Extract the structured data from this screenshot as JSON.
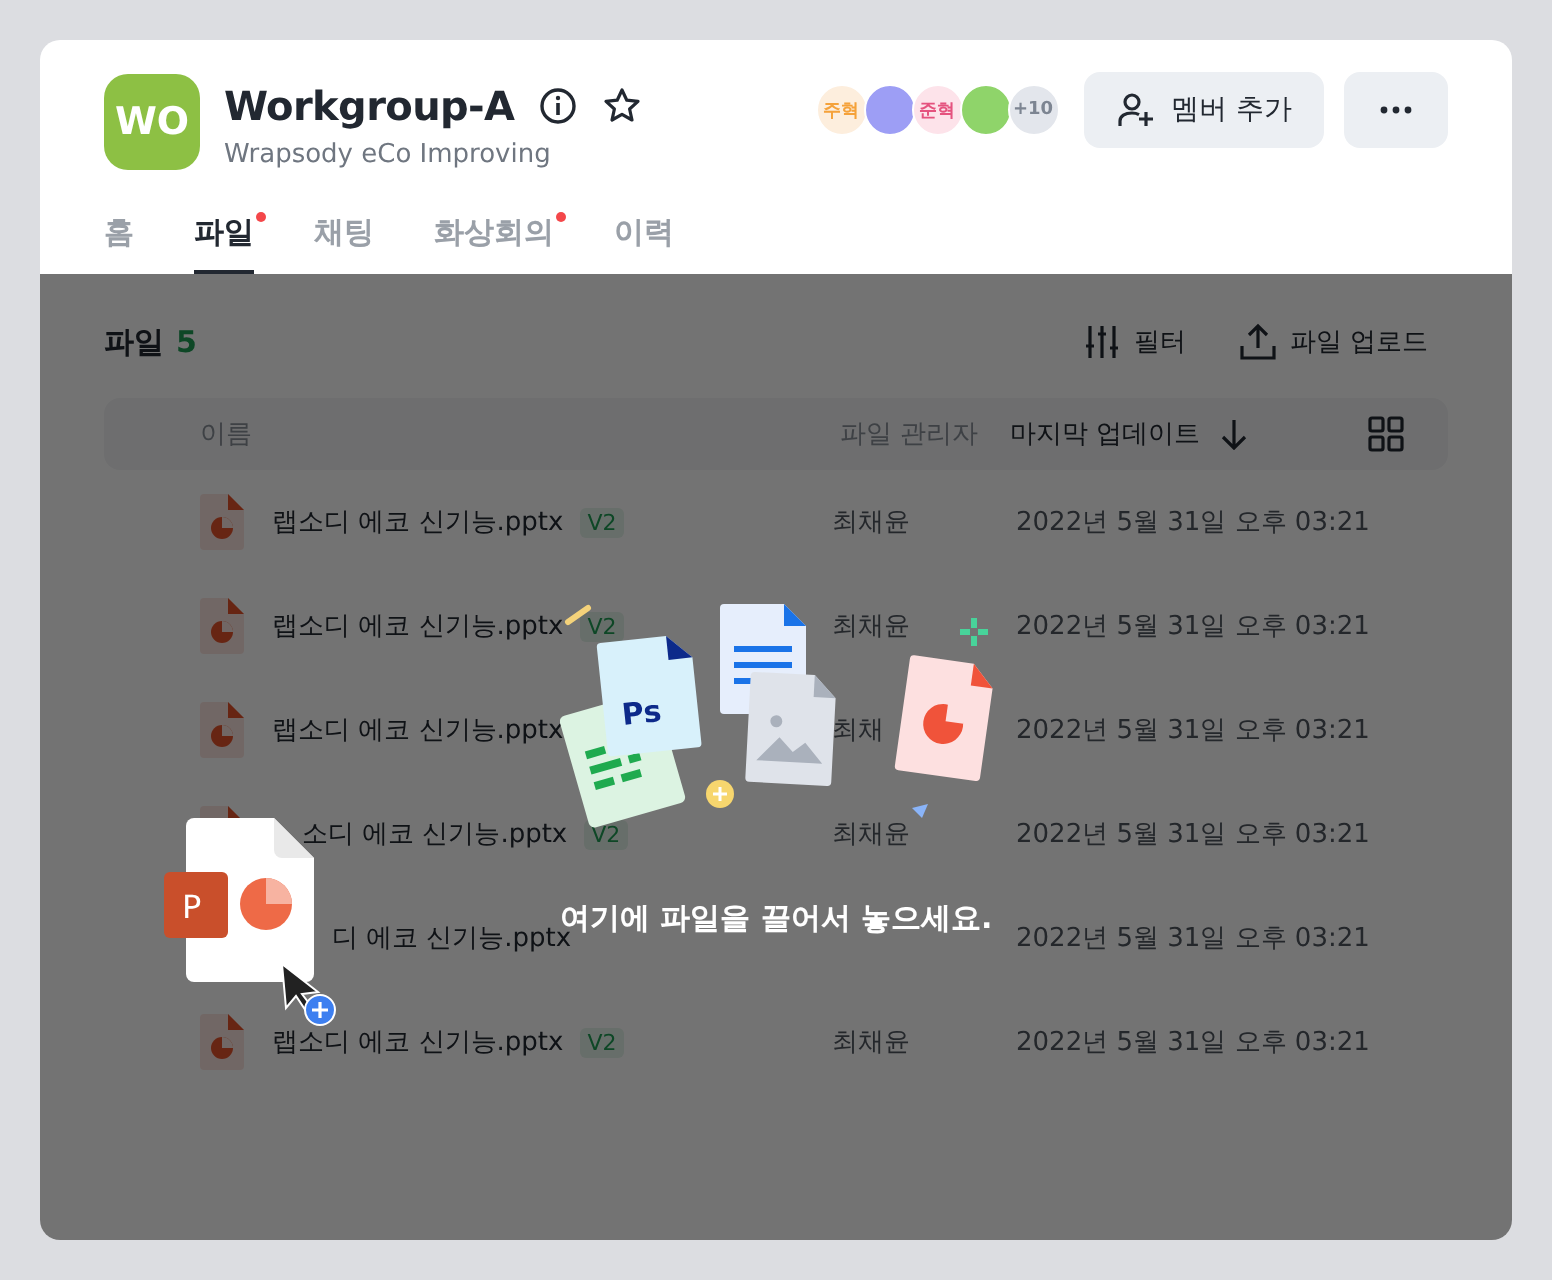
{
  "workgroup": {
    "initials": "WO",
    "title": "Workgroup-A",
    "subtitle": "Wrapsody eCo Improving",
    "favorite": false
  },
  "members": [
    {
      "kind": "initials",
      "label": "주혁",
      "color": "#fdeedd"
    },
    {
      "kind": "photo",
      "color": "#9d9ef5"
    },
    {
      "kind": "initials",
      "label": "준혁",
      "color": "#fde3ea"
    },
    {
      "kind": "photo",
      "color": "#8fd46a"
    },
    {
      "kind": "count",
      "label": "+10",
      "color": "#e3e6ec"
    }
  ],
  "add_member_button": "멤버 추가",
  "tabs": [
    {
      "label": "홈",
      "selected": false,
      "new": false
    },
    {
      "label": "파일",
      "selected": true,
      "new": true
    },
    {
      "label": "채팅",
      "selected": false,
      "new": false
    },
    {
      "label": "화상회의",
      "selected": false,
      "new": true
    },
    {
      "label": "이력",
      "selected": false,
      "new": false
    }
  ],
  "files_panel": {
    "title": "파일",
    "count": "5",
    "filter_button": "필터",
    "upload_button": "파일 업로드"
  },
  "table": {
    "columns": [
      {
        "label": "이름",
        "sorted": false
      },
      {
        "label": "파일 관리자",
        "sorted": false
      },
      {
        "label": "마지막 업데이트",
        "sorted": true
      }
    ],
    "rows": [
      {
        "kind": "plain",
        "name": "랩소디 에코 신기능.pptx",
        "version": "V2",
        "manager": "최채윤",
        "updated": "2022년 5월 31일 오후 03:21"
      },
      {
        "kind": "plain",
        "name": "랩소디 에코 신기능.pptx",
        "version": "V2",
        "manager": "최채윤",
        "updated": "2022년 5월 31일 오후 03:21"
      },
      {
        "kind": "plain",
        "name": "랩소디 에코 신기능.pptx",
        "manager": "최채",
        "updated": "2022년 5월 31일 오후 03:21"
      },
      {
        "kind": "covered",
        "name": "소디 에코 신기능.pptx",
        "version": "V2",
        "manager": "최채윤",
        "updated": "2022년 5월 31일 오후 03:21"
      },
      {
        "kind": "covered_wide",
        "name": "디 에코 신기능.pptx",
        "updated": "2022년 5월 31일 오후 03:21"
      },
      {
        "kind": "plain",
        "name": "랩소디 에코 신기능.pptx",
        "version": "V2",
        "manager": "최채윤",
        "updated": "2022년 5월 31일 오후 03:21"
      }
    ]
  },
  "drop_zone": {
    "active": true,
    "message": "여기에 파일을 끌어서 놓으세요.",
    "design_app_label": "Ps",
    "slide_app_label": "P"
  }
}
